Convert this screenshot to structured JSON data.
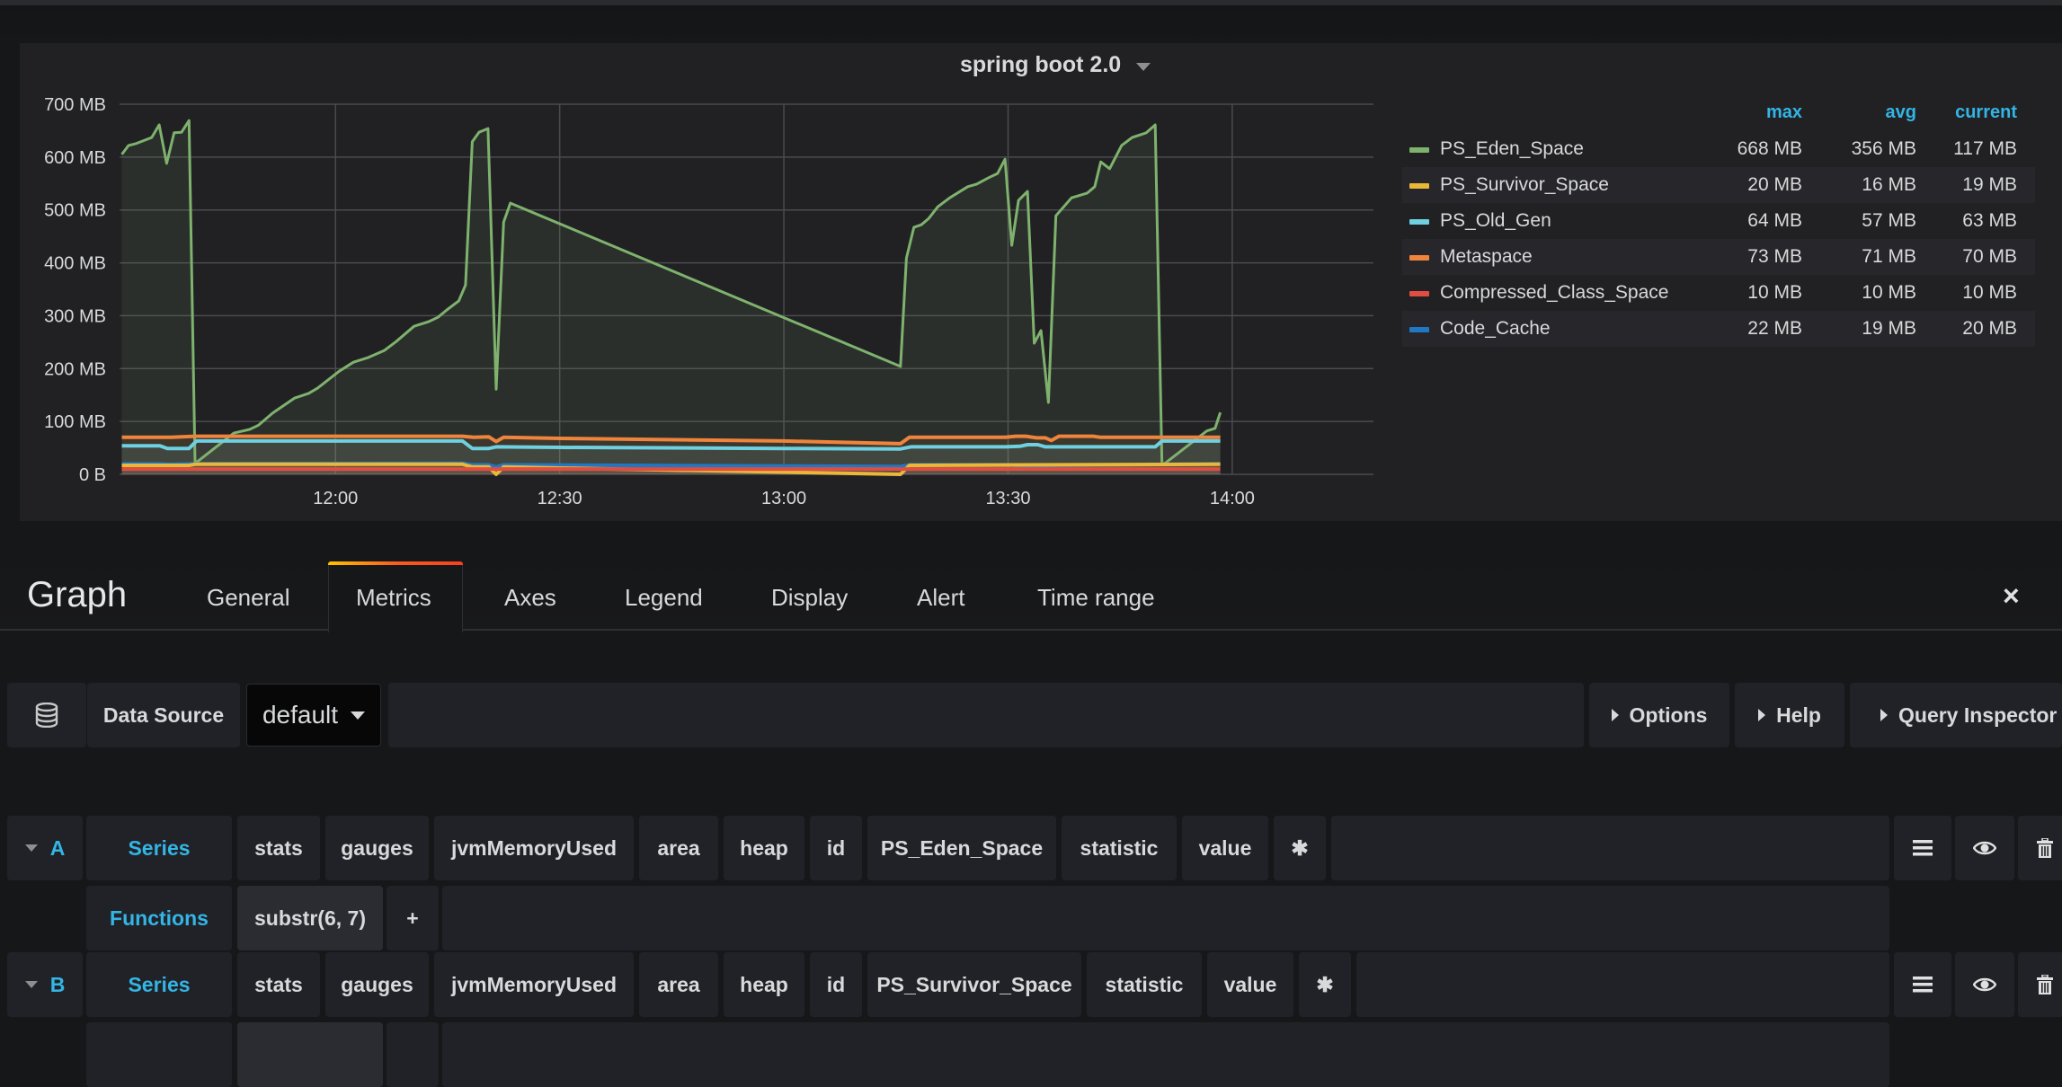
{
  "panel": {
    "title": "spring boot 2.0"
  },
  "legend": {
    "headers": {
      "max": "max",
      "avg": "avg",
      "current": "current"
    },
    "rows": [
      {
        "name": "PS_Eden_Space",
        "color": "#7eb26d",
        "max": "668 MB",
        "avg": "356 MB",
        "current": "117 MB"
      },
      {
        "name": "PS_Survivor_Space",
        "color": "#eab839",
        "max": "20 MB",
        "avg": "16 MB",
        "current": "19 MB"
      },
      {
        "name": "PS_Old_Gen",
        "color": "#6ed0e0",
        "max": "64 MB",
        "avg": "57 MB",
        "current": "63 MB"
      },
      {
        "name": "Metaspace",
        "color": "#ef843c",
        "max": "73 MB",
        "avg": "71 MB",
        "current": "70 MB"
      },
      {
        "name": "Compressed_Class_Space",
        "color": "#e24d42",
        "max": "10 MB",
        "avg": "10 MB",
        "current": "10 MB"
      },
      {
        "name": "Code_Cache",
        "color": "#1f78c1",
        "max": "22 MB",
        "avg": "19 MB",
        "current": "20 MB"
      }
    ]
  },
  "chart_data": {
    "type": "area",
    "title": "spring boot 2.0",
    "xlabel": "",
    "ylabel": "",
    "x_unit": "minutes since 11:30",
    "xlim": [
      1.1,
      168.9
    ],
    "ylim": [
      0,
      700
    ],
    "y_unit": "MB",
    "y_ticks": [
      "0 B",
      "100 MB",
      "200 MB",
      "300 MB",
      "400 MB",
      "500 MB",
      "600 MB",
      "700 MB"
    ],
    "x_ticks": [
      {
        "label": "12:00",
        "x": 30
      },
      {
        "label": "12:30",
        "x": 60
      },
      {
        "label": "13:00",
        "x": 90
      },
      {
        "label": "13:30",
        "x": 120
      },
      {
        "label": "14:00",
        "x": 150
      }
    ],
    "grid": true,
    "legend_position": "right",
    "series": [
      {
        "name": "PS_Eden_Space",
        "color": "#7eb26d",
        "points": [
          [
            1.4,
            605
          ],
          [
            2.3,
            622
          ],
          [
            3.2,
            625
          ],
          [
            5.4,
            637
          ],
          [
            6.4,
            661
          ],
          [
            7.4,
            588
          ],
          [
            8.4,
            646
          ],
          [
            9.4,
            647
          ],
          [
            10.4,
            669
          ],
          [
            11.2,
            22
          ],
          [
            11.6,
            25
          ],
          [
            16.4,
            78
          ],
          [
            18.5,
            85
          ],
          [
            19.7,
            93
          ],
          [
            21.6,
            116
          ],
          [
            24.5,
            144
          ],
          [
            26.4,
            153
          ],
          [
            27.6,
            163
          ],
          [
            30.5,
            195
          ],
          [
            32.4,
            212
          ],
          [
            34.4,
            221
          ],
          [
            36.5,
            234
          ],
          [
            38.1,
            251
          ],
          [
            40.5,
            280
          ],
          [
            42.5,
            289
          ],
          [
            43.7,
            297
          ],
          [
            44.9,
            311
          ],
          [
            46.5,
            328
          ],
          [
            47.4,
            358
          ],
          [
            48.3,
            629
          ],
          [
            49.2,
            647
          ],
          [
            50.4,
            654
          ],
          [
            51.5,
            161
          ],
          [
            52.5,
            477
          ],
          [
            53.4,
            513
          ],
          [
            105.6,
            204
          ],
          [
            106.4,
            409
          ],
          [
            107.4,
            467
          ],
          [
            108.4,
            472
          ],
          [
            109.4,
            484
          ],
          [
            110.6,
            506
          ],
          [
            112.2,
            523
          ],
          [
            114.6,
            544
          ],
          [
            115.8,
            549
          ],
          [
            117.4,
            561
          ],
          [
            118.6,
            569
          ],
          [
            119.6,
            596
          ],
          [
            120.5,
            433
          ],
          [
            121.4,
            518
          ],
          [
            122.6,
            535
          ],
          [
            123.5,
            248
          ],
          [
            124.4,
            272
          ],
          [
            125.4,
            136
          ],
          [
            126.4,
            489
          ],
          [
            128.5,
            523
          ],
          [
            130.6,
            532
          ],
          [
            131.6,
            544
          ],
          [
            132.4,
            591
          ],
          [
            133.6,
            578
          ],
          [
            135.2,
            622
          ],
          [
            136.6,
            637
          ],
          [
            138.5,
            646
          ],
          [
            139.7,
            661
          ],
          [
            140.6,
            19
          ],
          [
            141.1,
            22
          ],
          [
            146.6,
            82
          ],
          [
            147.7,
            87
          ],
          [
            148.4,
            117
          ]
        ]
      },
      {
        "name": "Metaspace",
        "color": "#ef843c",
        "points": [
          [
            1.4,
            70
          ],
          [
            8.0,
            70
          ],
          [
            11.2,
            72
          ],
          [
            47.0,
            72
          ],
          [
            48.5,
            70
          ],
          [
            50.5,
            71
          ],
          [
            51.5,
            62
          ],
          [
            52.5,
            70
          ],
          [
            60,
            68
          ],
          [
            90,
            63
          ],
          [
            105.6,
            58
          ],
          [
            106.8,
            70
          ],
          [
            119.6,
            70
          ],
          [
            121.0,
            72
          ],
          [
            122.4,
            72
          ],
          [
            123.8,
            69
          ],
          [
            125.0,
            69
          ],
          [
            125.8,
            64
          ],
          [
            126.8,
            72
          ],
          [
            131.4,
            72
          ],
          [
            132.4,
            70
          ],
          [
            148.4,
            70
          ]
        ]
      },
      {
        "name": "PS_Old_Gen",
        "color": "#6ed0e0",
        "points": [
          [
            1.4,
            54
          ],
          [
            6.5,
            54
          ],
          [
            7.5,
            49
          ],
          [
            10.4,
            49
          ],
          [
            11.4,
            63
          ],
          [
            47.0,
            63
          ],
          [
            48.3,
            49
          ],
          [
            50.5,
            49
          ],
          [
            51.5,
            52
          ],
          [
            60,
            51
          ],
          [
            90,
            49
          ],
          [
            105.6,
            48
          ],
          [
            107.0,
            52
          ],
          [
            119.6,
            52
          ],
          [
            121.6,
            53
          ],
          [
            122.6,
            56
          ],
          [
            124.0,
            56
          ],
          [
            125.0,
            52
          ],
          [
            131.4,
            52
          ],
          [
            139.7,
            52
          ],
          [
            140.6,
            63
          ],
          [
            148.4,
            63
          ]
        ]
      },
      {
        "name": "Code_Cache",
        "color": "#1f78c1",
        "points": [
          [
            1.4,
            20
          ],
          [
            6.5,
            20
          ],
          [
            7.5,
            19
          ],
          [
            11.2,
            20
          ],
          [
            47.0,
            21
          ],
          [
            48.3,
            18
          ],
          [
            50.5,
            18
          ],
          [
            51.5,
            14
          ],
          [
            52.5,
            18
          ],
          [
            105.6,
            15
          ],
          [
            107.0,
            18
          ],
          [
            120.5,
            18
          ],
          [
            121.5,
            16
          ],
          [
            125.4,
            15
          ],
          [
            126.4,
            17
          ],
          [
            148.4,
            20
          ]
        ]
      },
      {
        "name": "PS_Survivor_Space",
        "color": "#eab839",
        "points": [
          [
            1.4,
            17
          ],
          [
            10.4,
            17
          ],
          [
            11.2,
            19
          ],
          [
            47.0,
            19
          ],
          [
            48.3,
            14
          ],
          [
            50.5,
            14
          ],
          [
            51.5,
            0
          ],
          [
            52.5,
            14
          ],
          [
            105.6,
            0
          ],
          [
            106.8,
            17
          ],
          [
            148.4,
            19
          ]
        ]
      },
      {
        "name": "Compressed_Class_Space",
        "color": "#e24d42",
        "points": [
          [
            1.4,
            10
          ],
          [
            148.4,
            10
          ]
        ]
      }
    ]
  },
  "editor": {
    "title": "Graph",
    "tabs": [
      "General",
      "Metrics",
      "Axes",
      "Legend",
      "Display",
      "Alert",
      "Time range"
    ],
    "active_tab": "Metrics",
    "close_icon": "×"
  },
  "datasource": {
    "label": "Data Source",
    "value": "default",
    "options_label": "Options",
    "help_label": "Help",
    "query_inspector_label": "Query Inspector"
  },
  "queries": [
    {
      "ref": "A",
      "series_label": "Series",
      "segments": [
        "stats",
        "gauges",
        "jvmMemoryUsed",
        "area",
        "heap",
        "id",
        "PS_Eden_Space",
        "statistic",
        "value",
        "*"
      ],
      "functions_label": "Functions",
      "functions": [
        "substr(6, 7)"
      ],
      "add_function": "+"
    },
    {
      "ref": "B",
      "series_label": "Series",
      "segments": [
        "stats",
        "gauges",
        "jvmMemoryUsed",
        "area",
        "heap",
        "id",
        "PS_Survivor_Space",
        "statistic",
        "value",
        "*"
      ]
    }
  ]
}
